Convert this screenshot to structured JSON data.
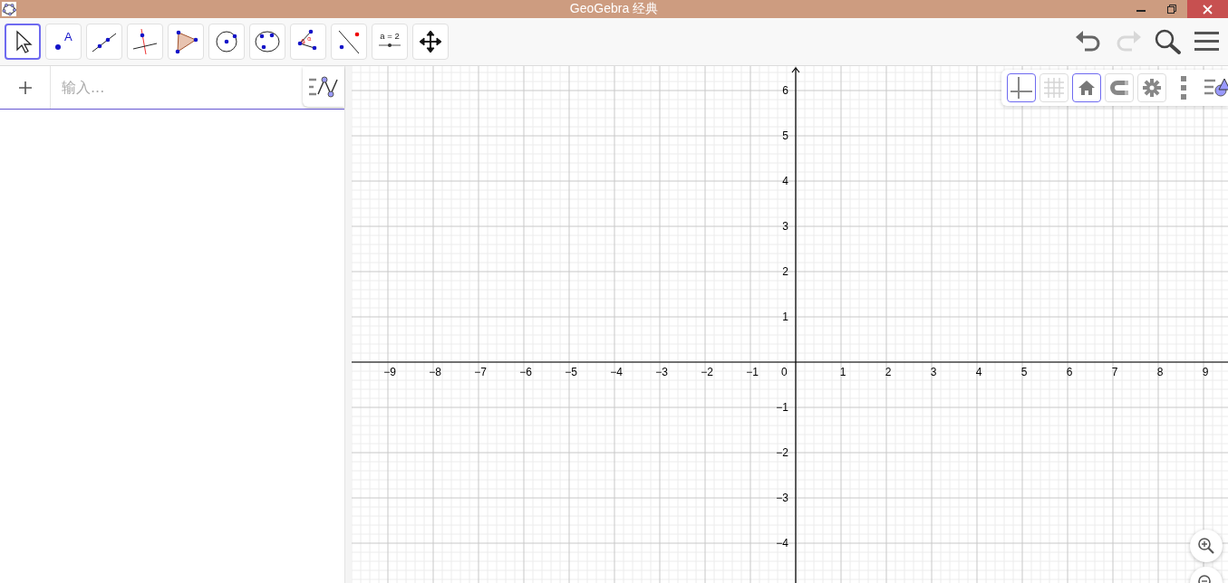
{
  "window": {
    "title": "GeoGebra 经典"
  },
  "toolbar": {
    "tools": [
      {
        "selected": true
      },
      {
        "selected": false,
        "label": "A"
      },
      {
        "selected": false
      },
      {
        "selected": false
      },
      {
        "selected": false
      },
      {
        "selected": false
      },
      {
        "selected": false
      },
      {
        "selected": false,
        "label": "α"
      },
      {
        "selected": false
      },
      {
        "selected": false,
        "label": "a = 2"
      },
      {
        "selected": false
      }
    ],
    "actions": [
      {
        "kind": "undo",
        "disabled": false
      },
      {
        "kind": "redo",
        "disabled": true
      },
      {
        "kind": "search"
      },
      {
        "kind": "menu"
      }
    ]
  },
  "algebra": {
    "input": {
      "placeholder": "输入..."
    }
  },
  "graphics": {
    "style_bar": [
      {
        "kind": "axes",
        "selected": true
      },
      {
        "kind": "grid",
        "selected": false
      },
      {
        "kind": "home",
        "selected": true
      },
      {
        "kind": "magnet",
        "selected": false
      },
      {
        "kind": "settings",
        "selected": false
      }
    ],
    "x_labels": [
      "−9",
      "−8",
      "−7",
      "−6",
      "−5",
      "−4",
      "−3",
      "−2",
      "−1",
      "0",
      "1",
      "2",
      "3",
      "4",
      "5",
      "6",
      "7",
      "8",
      "9"
    ],
    "y_positive_labels": [
      "6",
      "5",
      "4",
      "3",
      "2",
      "1"
    ],
    "y_negative_labels": [
      "−1",
      "−2",
      "−3",
      "−4"
    ]
  }
}
